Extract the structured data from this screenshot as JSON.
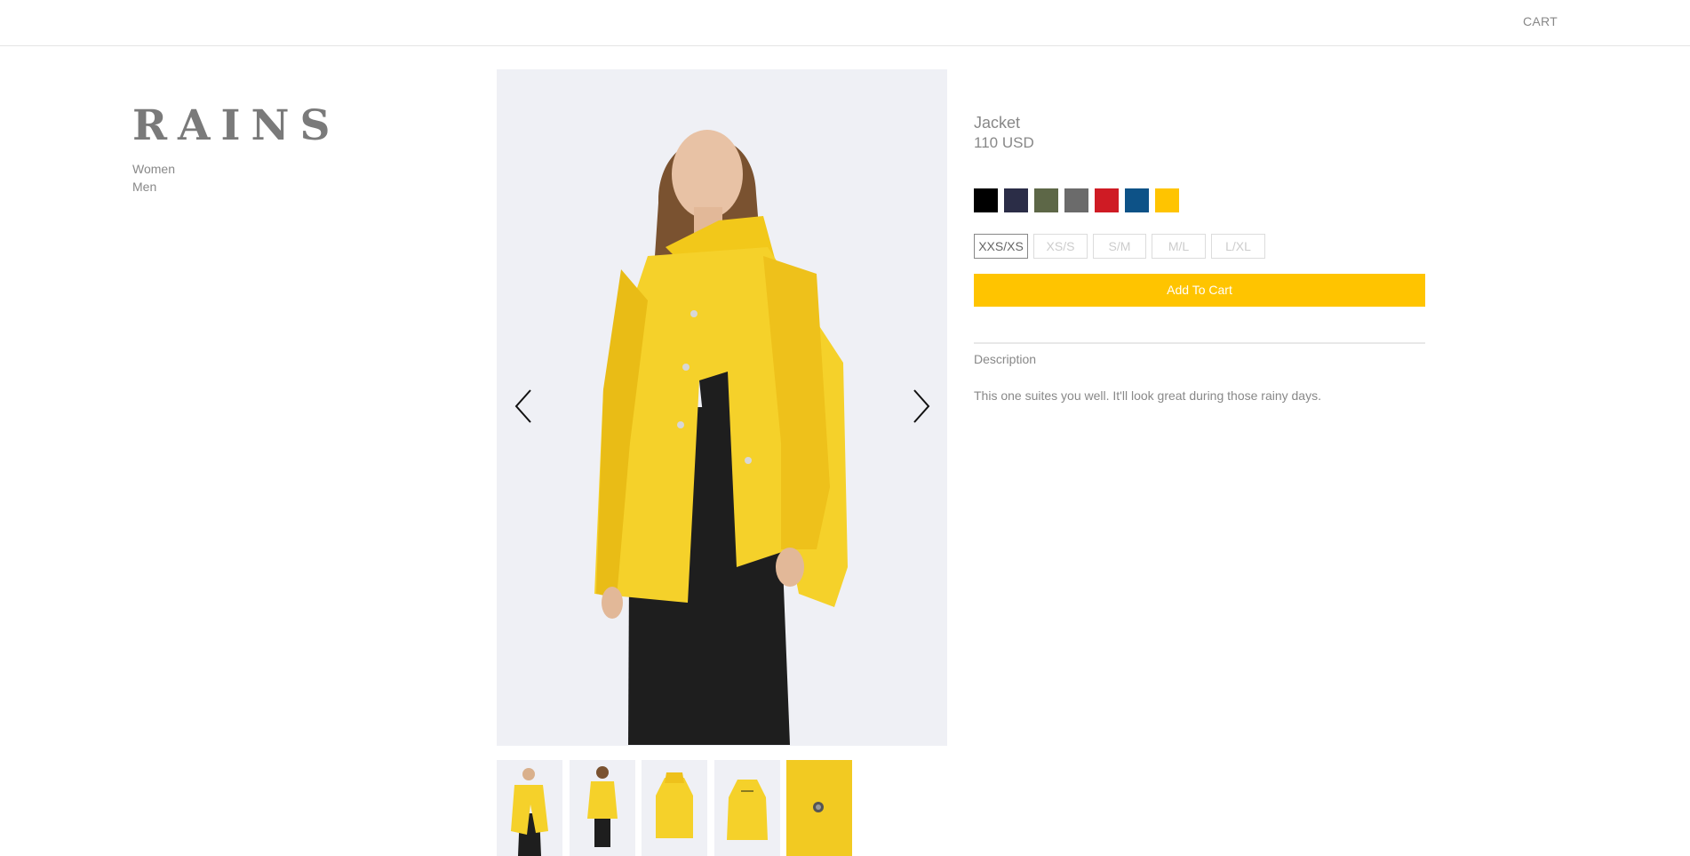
{
  "header": {
    "cart_label": "CART"
  },
  "brand": {
    "logo_text": "RAINS"
  },
  "nav": {
    "items": [
      {
        "label": "Women"
      },
      {
        "label": "Men"
      }
    ]
  },
  "gallery": {
    "main_image": "product-photo-yellow-jacket-front",
    "prev_icon": "chevron-left-icon",
    "next_icon": "chevron-right-icon",
    "thumbnails": [
      {
        "name": "thumbnail-front-model"
      },
      {
        "name": "thumbnail-back-model"
      },
      {
        "name": "thumbnail-jacket-front"
      },
      {
        "name": "thumbnail-jacket-back"
      },
      {
        "name": "thumbnail-fabric-detail"
      }
    ]
  },
  "product": {
    "title": "Jacket",
    "price": "110 USD",
    "colors": [
      "#000000",
      "#2b2d47",
      "#5d6747",
      "#6b6b6b",
      "#cf1b24",
      "#0d5287",
      "#ffc400"
    ],
    "selected_color": "#ffc400",
    "sizes": [
      "XXS/XS",
      "XS/S",
      "S/M",
      "M/L",
      "L/XL"
    ],
    "selected_size": "XXS/XS",
    "add_to_cart_label": "Add To Cart",
    "accent_color": "#ffc400",
    "description_heading": "Description",
    "description_text": "This one suites you well. It'll look great during those rainy days."
  }
}
